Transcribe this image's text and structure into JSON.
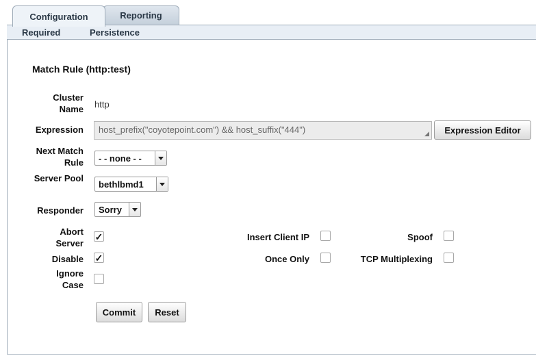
{
  "tabs": [
    {
      "label": "Configuration",
      "active": true
    },
    {
      "label": "Reporting",
      "active": false
    }
  ],
  "subnav": [
    "Required",
    "Persistence"
  ],
  "form": {
    "heading": "Match Rule (http:test)",
    "cluster_name_label": "Cluster Name",
    "cluster_name_value": "http",
    "expression_label": "Expression",
    "expression_value": "host_prefix(\"coyotepoint.com\") && host_suffix(\"444\")",
    "expression_editor_button": "Expression Editor",
    "next_match_rule_label": "Next Match Rule",
    "next_match_rule_value": "- - none - -",
    "server_pool_label": "Server Pool",
    "server_pool_value": "bethlbmd1",
    "responder_label": "Responder",
    "responder_value": "Sorry",
    "checkboxes": {
      "abort_server": {
        "label": "Abort Server",
        "checked": true
      },
      "disable": {
        "label": "Disable",
        "checked": true
      },
      "ignore_case": {
        "label": "Ignore Case",
        "checked": false
      },
      "insert_client_ip": {
        "label": "Insert Client IP",
        "checked": false
      },
      "once_only": {
        "label": "Once Only",
        "checked": false
      },
      "spoof": {
        "label": "Spoof",
        "checked": false
      },
      "tcp_multiplexing": {
        "label": "TCP Multiplexing",
        "checked": false
      }
    },
    "commit_button": "Commit",
    "reset_button": "Reset"
  },
  "check_glyph": "✓"
}
